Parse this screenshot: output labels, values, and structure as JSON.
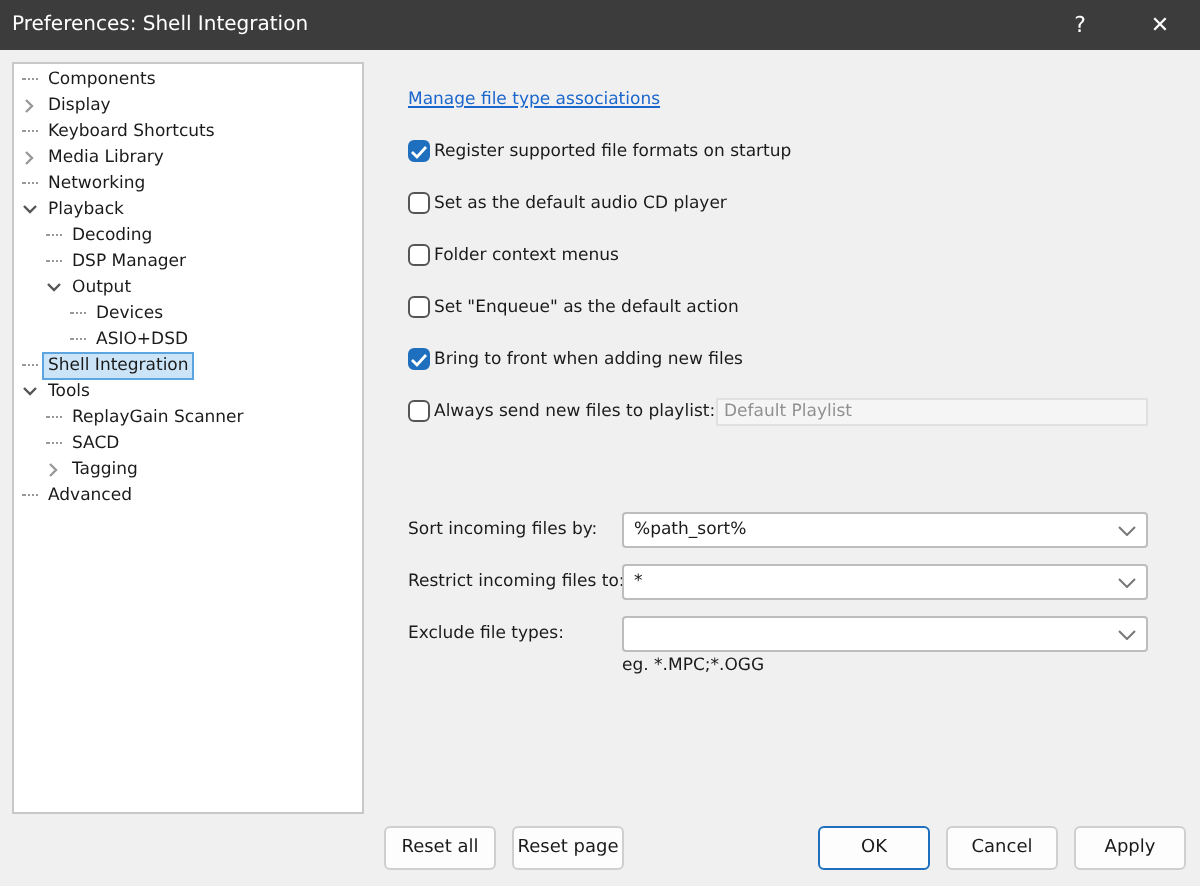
{
  "window": {
    "title": "Preferences: Shell Integration",
    "buttons": [
      "?",
      "✕"
    ]
  },
  "tree": [
    {
      "label": "Components",
      "kind": "leaf",
      "selected": false
    },
    {
      "label": "Display",
      "kind": "branch",
      "expanded": false,
      "selected": false
    },
    {
      "label": "Keyboard Shortcuts",
      "kind": "leaf",
      "selected": false
    },
    {
      "label": "Media Library",
      "kind": "branch",
      "expanded": false,
      "selected": false
    },
    {
      "label": "Networking",
      "kind": "leaf",
      "selected": false
    },
    {
      "label": "Playback",
      "kind": "branch",
      "expanded": true,
      "selected": false,
      "children": [
        {
          "label": "Decoding",
          "kind": "leaf",
          "selected": false
        },
        {
          "label": "DSP Manager",
          "kind": "leaf",
          "selected": false
        },
        {
          "label": "Output",
          "kind": "branch",
          "expanded": true,
          "selected": false,
          "children": [
            {
              "label": "Devices",
              "kind": "leaf",
              "selected": false
            },
            {
              "label": "ASIO+DSD",
              "kind": "leaf",
              "selected": false
            }
          ]
        }
      ]
    },
    {
      "label": "Shell Integration",
      "kind": "leaf",
      "selected": true
    },
    {
      "label": "Tools",
      "kind": "branch",
      "expanded": true,
      "selected": false,
      "children": [
        {
          "label": "ReplayGain Scanner",
          "kind": "leaf",
          "selected": false
        },
        {
          "label": "SACD",
          "kind": "leaf",
          "selected": false
        },
        {
          "label": "Tagging",
          "kind": "branch",
          "expanded": false,
          "selected": false
        }
      ]
    },
    {
      "label": "Advanced",
      "kind": "leaf",
      "selected": false
    }
  ],
  "link": "Manage file type associations",
  "options": [
    {
      "label": "Register supported file formats on startup",
      "checked": true
    },
    {
      "label": "Set as the default audio CD player",
      "checked": false
    },
    {
      "label": "Folder context menus",
      "checked": false
    },
    {
      "label": "Set \"Enqueue\" as the default action",
      "checked": false
    },
    {
      "label": "Bring to front when adding new files",
      "checked": true
    },
    {
      "label": "Always send new files to playlist:",
      "checked": false,
      "field": {
        "value": "Default Playlist",
        "disabled": true
      }
    }
  ],
  "combos": [
    {
      "label": "Sort incoming files by:",
      "value": "%path_sort%"
    },
    {
      "label": "Restrict incoming files to:",
      "value": "*"
    },
    {
      "label": "Exclude file types:",
      "hint": "eg. *.MPC;*.OGG"
    }
  ],
  "left_buttons": [
    "Reset all",
    "Reset page"
  ],
  "right_buttons": [
    {
      "label": "OK",
      "default": true
    },
    {
      "label": "Cancel",
      "default": false
    },
    {
      "label": "Apply",
      "default": false
    }
  ]
}
